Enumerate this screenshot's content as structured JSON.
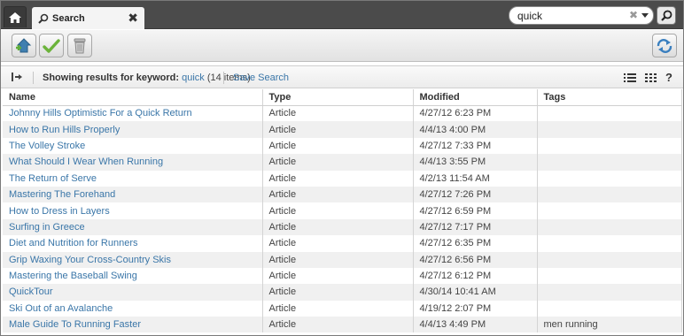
{
  "tab": {
    "label": "Search",
    "close": "✖"
  },
  "search": {
    "value": "quick",
    "clear": "✖"
  },
  "results": {
    "label": "Showing results for keyword:",
    "keyword": "quick",
    "count": "(14 items)",
    "save_search": "Save Search"
  },
  "view": {
    "help": "?"
  },
  "columns": [
    "Name",
    "Type",
    "Modified",
    "Tags"
  ],
  "rows": [
    {
      "name": "Johnny Hills Optimistic For a Quick Return",
      "type": "Article",
      "modified": "4/27/12 6:23 PM",
      "tags": ""
    },
    {
      "name": "How to Run Hills Properly",
      "type": "Article",
      "modified": "4/4/13 4:00 PM",
      "tags": ""
    },
    {
      "name": "The Volley Stroke",
      "type": "Article",
      "modified": "4/27/12 7:33 PM",
      "tags": ""
    },
    {
      "name": "What Should I Wear When Running",
      "type": "Article",
      "modified": "4/4/13 3:55 PM",
      "tags": ""
    },
    {
      "name": "The Return of Serve",
      "type": "Article",
      "modified": "4/2/13 11:54 AM",
      "tags": ""
    },
    {
      "name": "Mastering The Forehand",
      "type": "Article",
      "modified": "4/27/12 7:26 PM",
      "tags": ""
    },
    {
      "name": "How to Dress in Layers",
      "type": "Article",
      "modified": "4/27/12 6:59 PM",
      "tags": ""
    },
    {
      "name": "Surfing in Greece",
      "type": "Article",
      "modified": "4/27/12 7:17 PM",
      "tags": ""
    },
    {
      "name": "Diet and Nutrition for Runners",
      "type": "Article",
      "modified": "4/27/12 6:35 PM",
      "tags": ""
    },
    {
      "name": "Grip Waxing Your Cross-Country Skis",
      "type": "Article",
      "modified": "4/27/12 6:56 PM",
      "tags": ""
    },
    {
      "name": "Mastering the Baseball Swing",
      "type": "Article",
      "modified": "4/27/12 6:12 PM",
      "tags": ""
    },
    {
      "name": "QuickTour",
      "type": "Article",
      "modified": "4/30/14 10:41 AM",
      "tags": ""
    },
    {
      "name": "Ski Out of an Avalanche",
      "type": "Article",
      "modified": "4/19/12 2:07 PM",
      "tags": ""
    },
    {
      "name": "Male Guide To Running Faster",
      "type": "Article",
      "modified": "4/4/13 4:49 PM",
      "tags": "men running"
    }
  ],
  "icons": {
    "home": "home-icon",
    "search": "magnifier-icon",
    "toolbar": [
      "add-icon",
      "checkmark-icon",
      "trash-icon",
      "refresh-icon"
    ],
    "results_bar": [
      "collapse-panel-icon",
      "list-view-icon",
      "grid-view-icon",
      "help-icon"
    ]
  },
  "colors": {
    "link": "#3a76a8",
    "topbar": "#4b4b4b",
    "row_alt": "#f0f0f0",
    "check": "#6bb33a"
  }
}
